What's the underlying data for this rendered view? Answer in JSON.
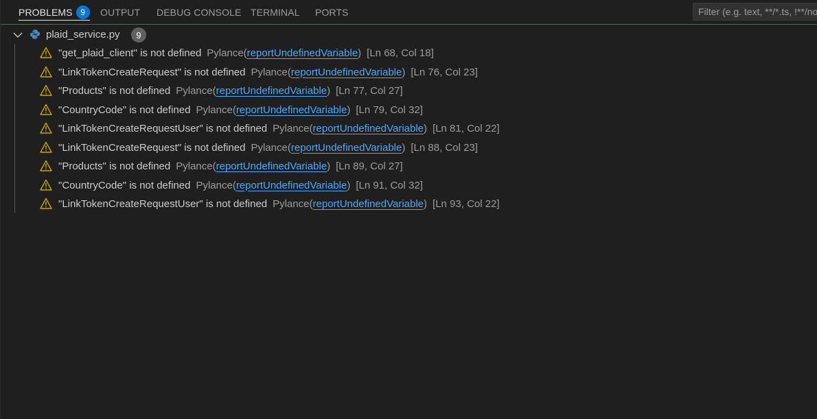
{
  "tabs": [
    {
      "label": "PROBLEMS",
      "badge": "9",
      "active": true
    },
    {
      "label": "OUTPUT"
    },
    {
      "label": "DEBUG CONSOLE"
    },
    {
      "label": "TERMINAL"
    },
    {
      "label": "PORTS"
    }
  ],
  "filter": {
    "placeholder": "Filter (e.g. text, **/*.ts, !**/node_modules/**)"
  },
  "file": {
    "name": "plaid_service.py",
    "count": "9",
    "icon": "python-icon",
    "expanded": true
  },
  "problems": [
    {
      "message": "\"get_plaid_client\" is not defined",
      "source": "Pylance",
      "open_paren": "(",
      "code": "reportUndefinedVariable",
      "close_paren": ")",
      "location": "[Ln 68, Col 18]"
    },
    {
      "message": "\"LinkTokenCreateRequest\" is not defined",
      "source": "Pylance",
      "open_paren": "(",
      "code": "reportUndefinedVariable",
      "close_paren": ")",
      "location": "[Ln 76, Col 23]"
    },
    {
      "message": "\"Products\" is not defined",
      "source": "Pylance",
      "open_paren": "(",
      "code": "reportUndefinedVariable",
      "close_paren": ")",
      "location": "[Ln 77, Col 27]"
    },
    {
      "message": "\"CountryCode\" is not defined",
      "source": "Pylance",
      "open_paren": "(",
      "code": "reportUndefinedVariable",
      "close_paren": ")",
      "location": "[Ln 79, Col 32]"
    },
    {
      "message": "\"LinkTokenCreateRequestUser\" is not defined",
      "source": "Pylance",
      "open_paren": "(",
      "code": "reportUndefinedVariable",
      "close_paren": ")",
      "location": "[Ln 81, Col 22]"
    },
    {
      "message": "\"LinkTokenCreateRequest\" is not defined",
      "source": "Pylance",
      "open_paren": "(",
      "code": "reportUndefinedVariable",
      "close_paren": ")",
      "location": "[Ln 88, Col 23]"
    },
    {
      "message": "\"Products\" is not defined",
      "source": "Pylance",
      "open_paren": "(",
      "code": "reportUndefinedVariable",
      "close_paren": ")",
      "location": "[Ln 89, Col 27]"
    },
    {
      "message": "\"CountryCode\" is not defined",
      "source": "Pylance",
      "open_paren": "(",
      "code": "reportUndefinedVariable",
      "close_paren": ")",
      "location": "[Ln 91, Col 32]"
    },
    {
      "message": "\"LinkTokenCreateRequestUser\" is not defined",
      "source": "Pylance",
      "open_paren": "(",
      "code": "reportUndefinedVariable",
      "close_paren": ")",
      "location": "[Ln 93, Col 22]"
    }
  ],
  "colors": {
    "background": "#1f1f1f",
    "accent": "#0078d4",
    "warning": "#cca700",
    "link": "#4daafc"
  }
}
